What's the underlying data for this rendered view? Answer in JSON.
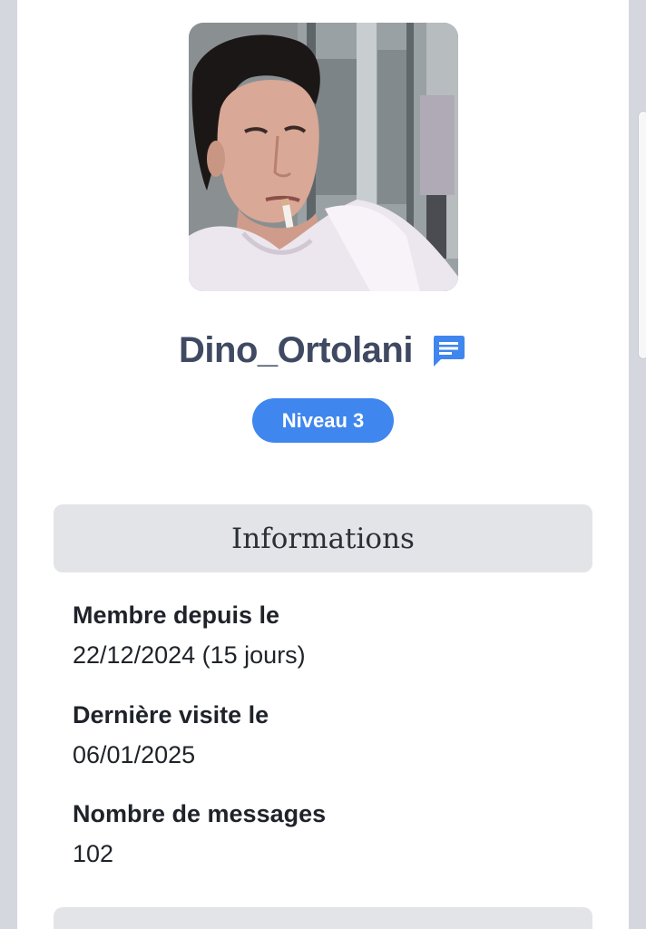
{
  "profile": {
    "username": "Dino_Ortolani",
    "level_badge": "Niveau 3",
    "avatar_alt": "avatar"
  },
  "info_section": {
    "title": "Informations",
    "items": [
      {
        "label": "Membre depuis le",
        "value": "22/12/2024 (15 jours)"
      },
      {
        "label": "Dernière visite le",
        "value": "06/01/2025"
      },
      {
        "label": "Nombre de messages",
        "value": "102"
      }
    ]
  },
  "icons": {
    "message": "message-icon"
  },
  "colors": {
    "accent": "#3f86ee",
    "username": "#3f4a62",
    "section_bg": "#e3e4e8",
    "page_bg": "#d4d7de"
  }
}
